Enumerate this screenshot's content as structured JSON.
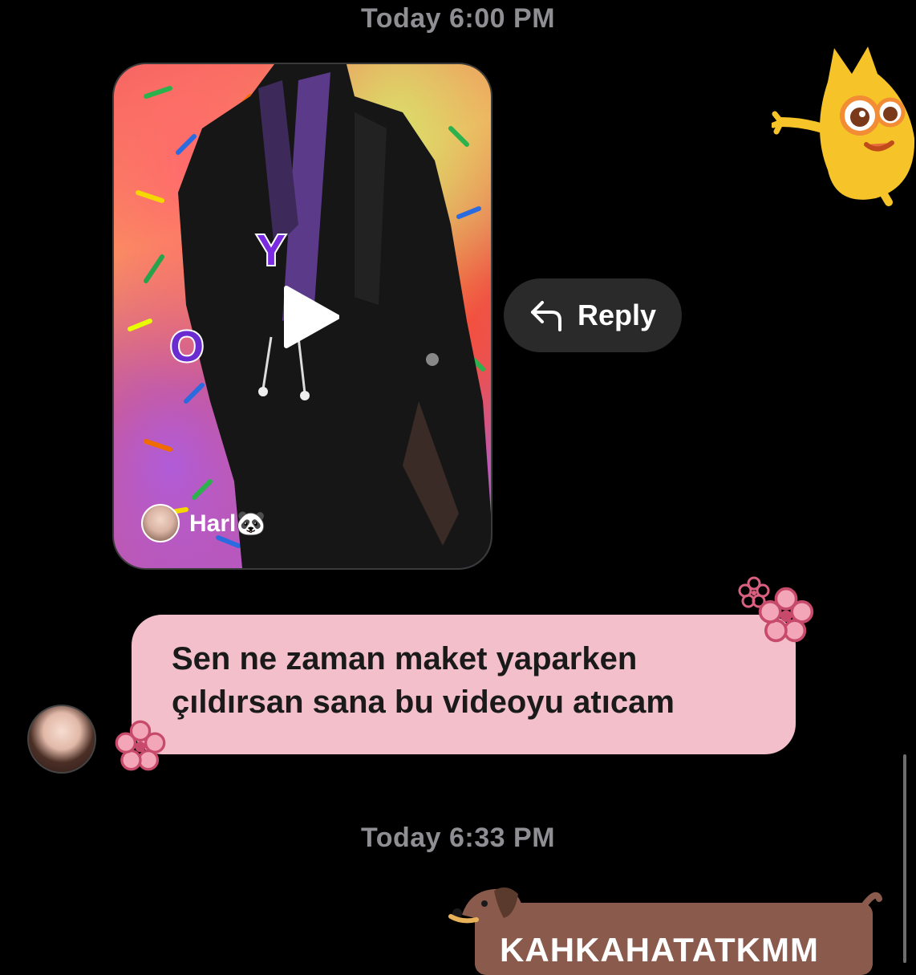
{
  "timestamps": [
    "Today 6:00 PM",
    "Today 6:33 PM"
  ],
  "video_message": {
    "author_name": "Harl🐼",
    "media_text": "YO"
  },
  "reply": {
    "label": "Reply"
  },
  "incoming_message": {
    "text": "Sen ne zaman maket yaparken\nçıldırsan sana bu videoyu atıcam"
  },
  "outgoing_message": {
    "text": "KAHKAHATATKMM"
  },
  "colors": {
    "background": "#000000",
    "timestamp": "#8e8e93",
    "bubble_pink": "#f2bfcb",
    "reply_pill": "#2a2a2a",
    "dog_bubble": "#8a5b4c",
    "flower": "#d9607e"
  },
  "icons": [
    "play-icon",
    "reply-arrow-icon",
    "mascot-sticker",
    "flower-sticker",
    "dog-sticker"
  ]
}
